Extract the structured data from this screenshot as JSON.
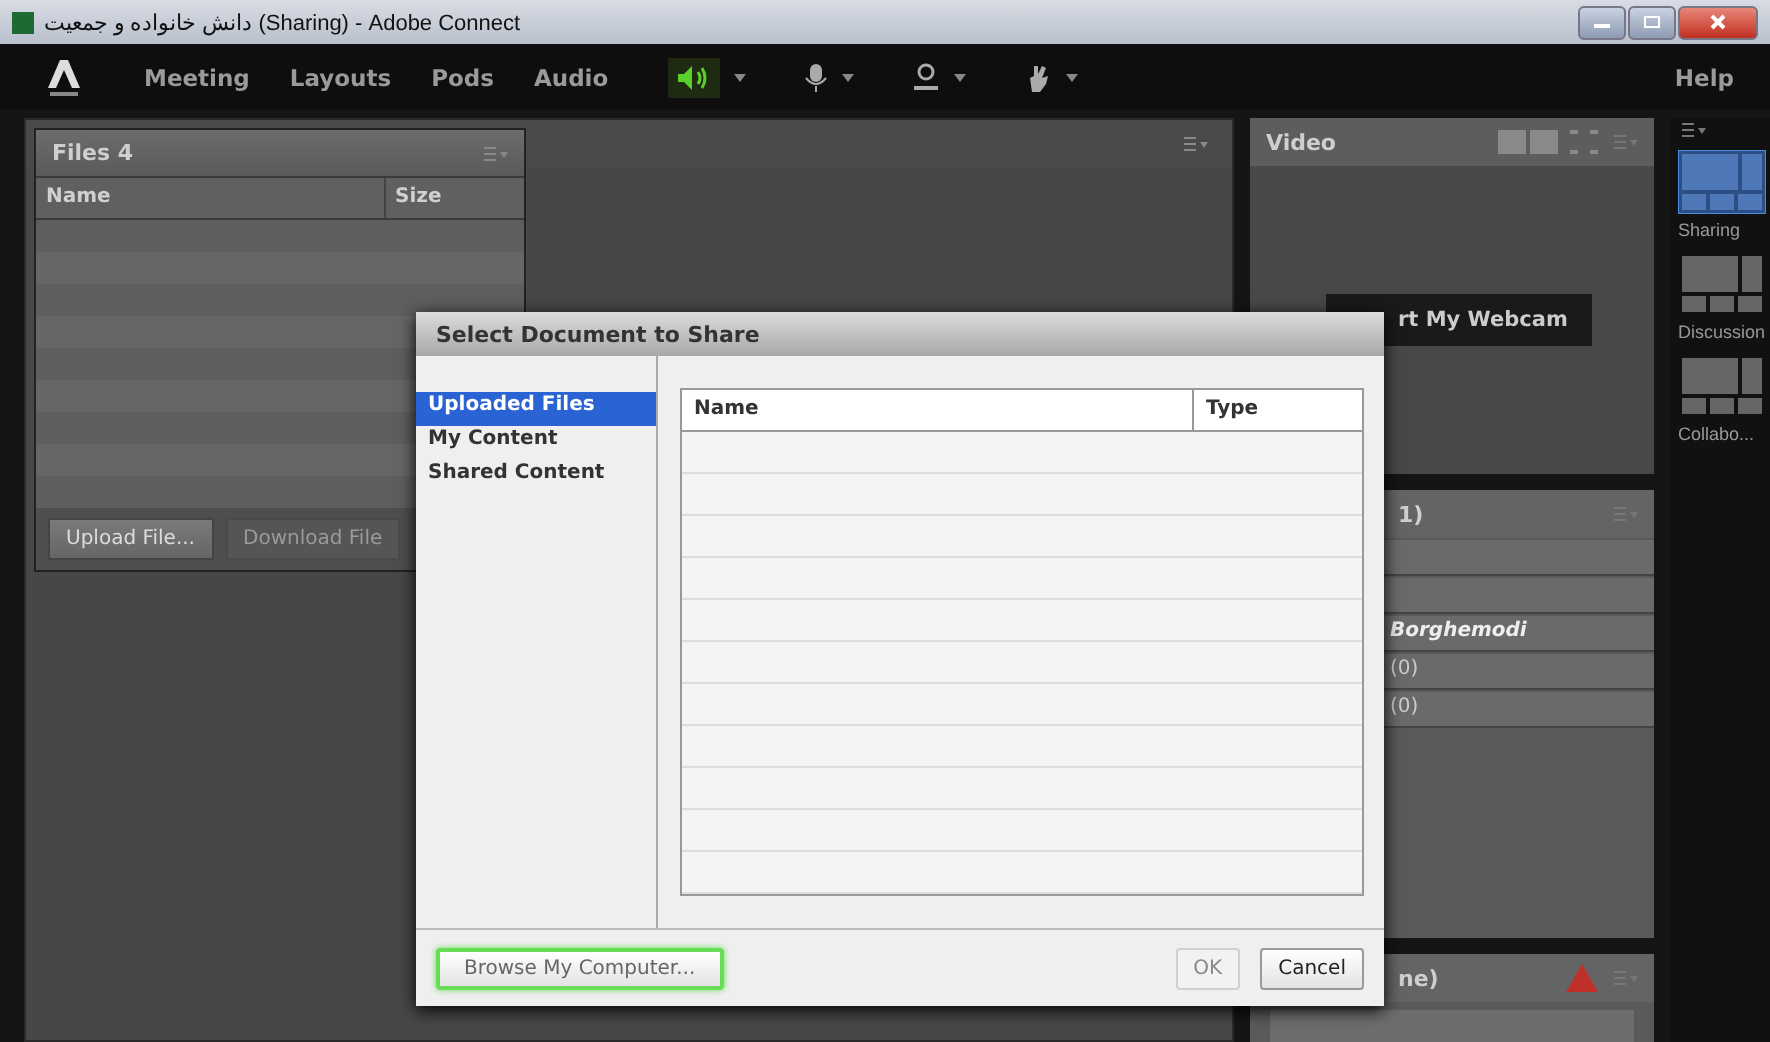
{
  "window": {
    "title": "دانش خانواده و جمعیت (Sharing) - Adobe Connect"
  },
  "menu": [
    {
      "label": "Meeting"
    },
    {
      "label": "Layouts"
    },
    {
      "label": "Pods"
    },
    {
      "label": "Audio"
    }
  ],
  "speaker": {
    "on": true
  },
  "help": "Help",
  "files_pod": {
    "title": "Files 4",
    "columns": [
      "Name",
      "Size"
    ],
    "buttons": [
      {
        "label": "Upload File...",
        "disabled": false
      },
      {
        "label": "Download File",
        "disabled": true
      }
    ]
  },
  "video_pod": {
    "title": "Video",
    "webcam_button": "rt My Webcam"
  },
  "attendees_pod": {
    "title": "1)",
    "rows": [
      {
        "text": "Borghemodi"
      },
      {
        "text": "(0)"
      },
      {
        "text": "(0)"
      }
    ]
  },
  "chat_pod": {
    "title": "ne)"
  },
  "layouts": [
    {
      "label": "Sharing",
      "selected": true
    },
    {
      "label": "Discussion",
      "selected": false
    },
    {
      "label": "Collabo...",
      "selected": false
    }
  ],
  "dialog": {
    "title": "Select Document to Share",
    "sources": [
      {
        "label": "Uploaded Files",
        "selected": true
      },
      {
        "label": "My Content",
        "selected": false
      },
      {
        "label": "Shared Content",
        "selected": false
      }
    ],
    "columns": [
      "Name",
      "Type"
    ],
    "buttons": [
      {
        "label": "Browse My Computer...",
        "kind": "browse"
      },
      {
        "label": "OK",
        "kind": "ok",
        "disabled": true
      },
      {
        "label": "Cancel",
        "kind": "cancel",
        "disabled": false
      }
    ]
  }
}
